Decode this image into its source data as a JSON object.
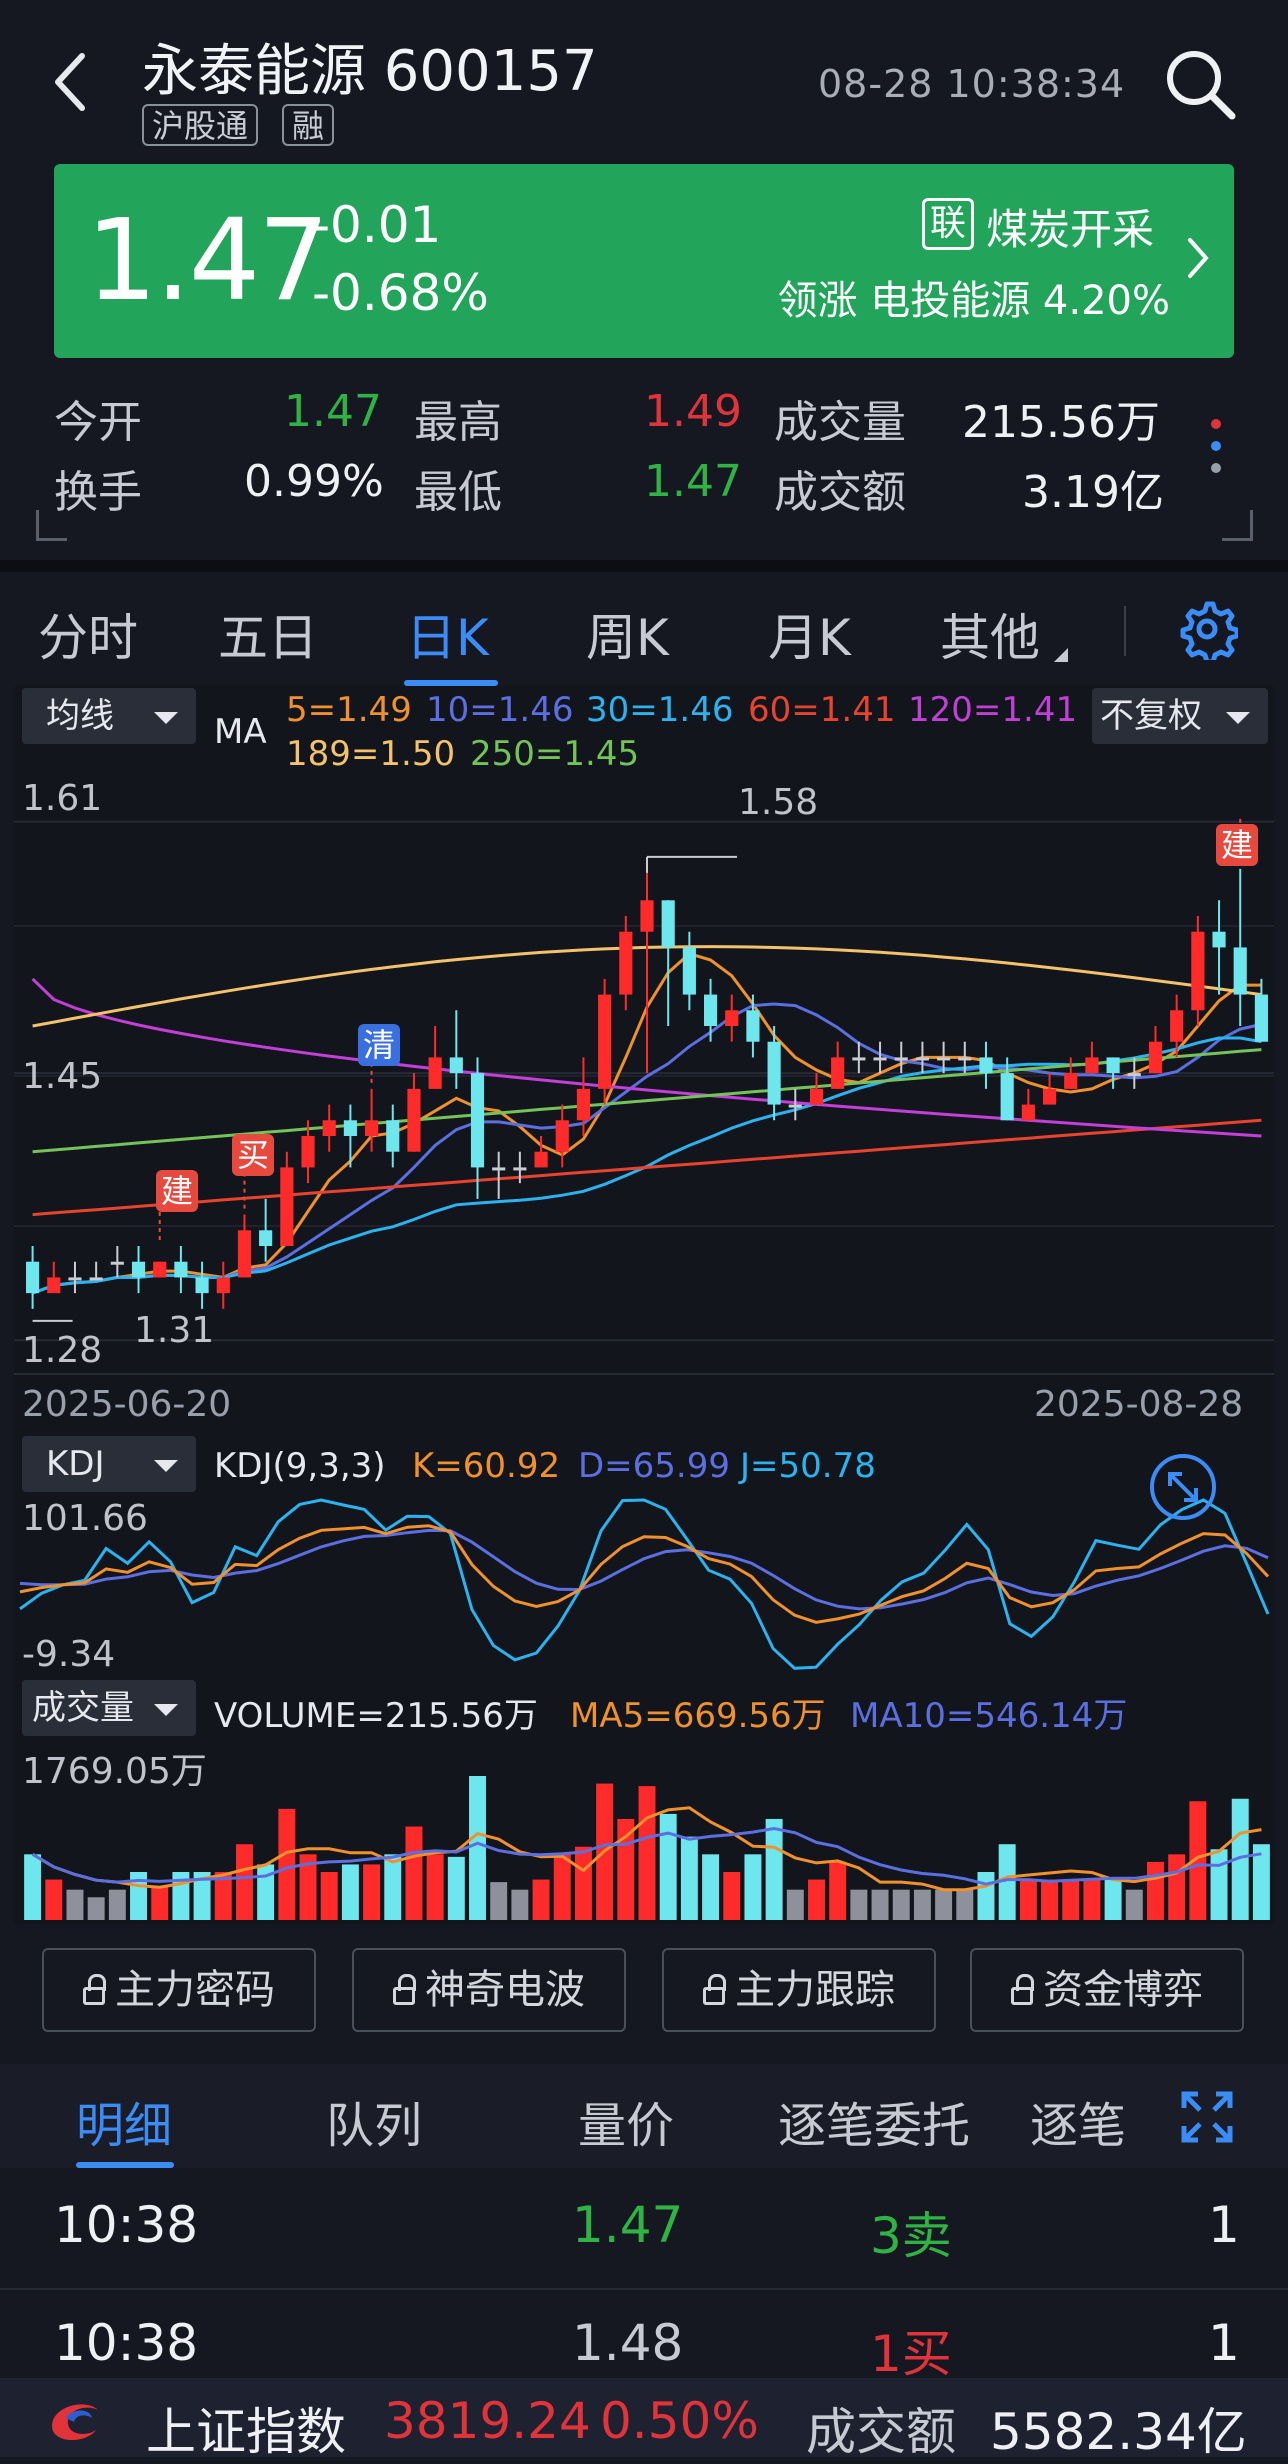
{
  "header": {
    "title": "永泰能源 600157",
    "tags": [
      "沪股通",
      "融"
    ],
    "time": "08-28 10:38:34"
  },
  "quote": {
    "price": "1.47",
    "change": "-0.01",
    "change_pct": "-0.68%",
    "link_badge": "联",
    "industry": "煤炭开采",
    "leading": "领涨 电投能源 4.20%"
  },
  "stats": {
    "open_label": "今开",
    "open": "1.47",
    "high_label": "最高",
    "high": "1.49",
    "volume_label": "成交量",
    "volume": "215.56万",
    "turnover_label": "换手",
    "turnover": "0.99%",
    "low_label": "最低",
    "low": "1.47",
    "amount_label": "成交额",
    "amount": "3.19亿"
  },
  "tabs": [
    "分时",
    "五日",
    "日K",
    "周K",
    "月K",
    "其他"
  ],
  "active_tab": "日K",
  "chart": {
    "ma_selector": "均线",
    "ma_label": "MA",
    "ma_values": [
      "5=1.49",
      "10=1.46",
      "30=1.46",
      "60=1.41",
      "120=1.41",
      "189=1.50",
      "250=1.45"
    ],
    "ma_colors": [
      "#f0912d",
      "#5b6fe0",
      "#2bb3f0",
      "#e8432e",
      "#c23fd8",
      "#f3c26b",
      "#74c25a"
    ],
    "adjust_selector": "不复权",
    "y_top": "1.61",
    "y_mid": "1.45",
    "y_low": "1.28",
    "max_label": "1.58",
    "min_label": "1.31",
    "date_start": "2025-06-20",
    "date_end": "2025-08-28",
    "signals": [
      "建",
      "买",
      "清",
      "建"
    ],
    "candles": [
      [
        1.33,
        1.31,
        1.34,
        1.3
      ],
      [
        1.31,
        1.32,
        1.33,
        1.31
      ],
      [
        1.32,
        1.32,
        1.33,
        1.31
      ],
      [
        1.32,
        1.32,
        1.33,
        1.32
      ],
      [
        1.33,
        1.33,
        1.34,
        1.32
      ],
      [
        1.33,
        1.32,
        1.34,
        1.31
      ],
      [
        1.32,
        1.33,
        1.33,
        1.32
      ],
      [
        1.33,
        1.32,
        1.34,
        1.31
      ],
      [
        1.32,
        1.31,
        1.33,
        1.3
      ],
      [
        1.31,
        1.32,
        1.33,
        1.3
      ],
      [
        1.32,
        1.35,
        1.36,
        1.32
      ],
      [
        1.35,
        1.34,
        1.37,
        1.33
      ],
      [
        1.34,
        1.39,
        1.4,
        1.34
      ],
      [
        1.39,
        1.41,
        1.42,
        1.38
      ],
      [
        1.41,
        1.42,
        1.43,
        1.4
      ],
      [
        1.42,
        1.41,
        1.43,
        1.39
      ],
      [
        1.41,
        1.42,
        1.44,
        1.4
      ],
      [
        1.42,
        1.4,
        1.43,
        1.39
      ],
      [
        1.4,
        1.44,
        1.45,
        1.4
      ],
      [
        1.44,
        1.46,
        1.48,
        1.44
      ],
      [
        1.46,
        1.45,
        1.49,
        1.44
      ],
      [
        1.45,
        1.39,
        1.46,
        1.37
      ],
      [
        1.39,
        1.39,
        1.4,
        1.37
      ],
      [
        1.39,
        1.39,
        1.4,
        1.38
      ],
      [
        1.39,
        1.4,
        1.41,
        1.39
      ],
      [
        1.4,
        1.42,
        1.43,
        1.39
      ],
      [
        1.42,
        1.44,
        1.46,
        1.41
      ],
      [
        1.44,
        1.5,
        1.51,
        1.43
      ],
      [
        1.5,
        1.54,
        1.55,
        1.49
      ],
      [
        1.54,
        1.56,
        1.58,
        1.45
      ],
      [
        1.56,
        1.53,
        1.56,
        1.48
      ],
      [
        1.53,
        1.5,
        1.54,
        1.49
      ],
      [
        1.5,
        1.48,
        1.51,
        1.47
      ],
      [
        1.48,
        1.49,
        1.5,
        1.47
      ],
      [
        1.49,
        1.47,
        1.5,
        1.46
      ],
      [
        1.47,
        1.43,
        1.48,
        1.42
      ],
      [
        1.43,
        1.43,
        1.44,
        1.42
      ],
      [
        1.43,
        1.44,
        1.45,
        1.43
      ],
      [
        1.44,
        1.46,
        1.47,
        1.44
      ],
      [
        1.46,
        1.46,
        1.47,
        1.45
      ],
      [
        1.46,
        1.46,
        1.47,
        1.45
      ],
      [
        1.46,
        1.46,
        1.47,
        1.45
      ],
      [
        1.46,
        1.46,
        1.47,
        1.45
      ],
      [
        1.46,
        1.46,
        1.47,
        1.45
      ],
      [
        1.46,
        1.46,
        1.47,
        1.45
      ],
      [
        1.46,
        1.45,
        1.47,
        1.44
      ],
      [
        1.45,
        1.42,
        1.46,
        1.42
      ],
      [
        1.42,
        1.43,
        1.44,
        1.42
      ],
      [
        1.43,
        1.44,
        1.45,
        1.43
      ],
      [
        1.44,
        1.45,
        1.46,
        1.44
      ],
      [
        1.45,
        1.46,
        1.47,
        1.45
      ],
      [
        1.46,
        1.45,
        1.46,
        1.44
      ],
      [
        1.45,
        1.45,
        1.46,
        1.44
      ],
      [
        1.45,
        1.47,
        1.48,
        1.45
      ],
      [
        1.47,
        1.49,
        1.5,
        1.46
      ],
      [
        1.49,
        1.54,
        1.55,
        1.48
      ],
      [
        1.54,
        1.53,
        1.56,
        1.5
      ],
      [
        1.53,
        1.5,
        1.58,
        1.48
      ],
      [
        1.5,
        1.47,
        1.51,
        1.47
      ]
    ],
    "kdj_selector": "KDJ",
    "kdj_label": "KDJ(9,3,3)",
    "k": "K=60.92",
    "d": "D=65.99",
    "j": "J=50.78",
    "kdj_top": "101.66",
    "kdj_bottom": "-9.34",
    "vol_selector": "成交量",
    "vol_label": "VOLUME=215.56万",
    "vol_ma5": "MA5=669.56万",
    "vol_ma10": "MA10=546.14万",
    "vol_top": "1769.05万"
  },
  "tools": [
    "主力密码",
    "神奇电波",
    "主力跟踪",
    "资金博弈"
  ],
  "detail_tabs": [
    "明细",
    "队列",
    "量价",
    "逐笔委托",
    "逐笔"
  ],
  "trades": [
    {
      "time": "10:38",
      "price": "1.47",
      "side": "3卖",
      "qty": "1"
    },
    {
      "time": "10:38",
      "price": "1.48",
      "side": "1买",
      "qty": "1"
    }
  ],
  "footer": {
    "index_name": "上证指数",
    "index_value": "3819.24",
    "index_pct": "0.50%",
    "amount_label": "成交额",
    "amount": "5582.34亿"
  }
}
